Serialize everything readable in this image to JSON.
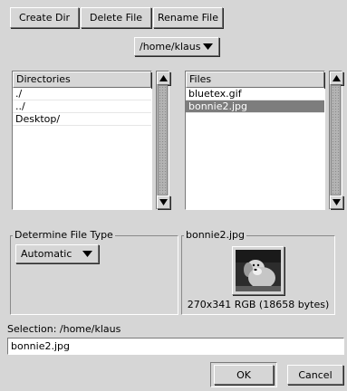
{
  "toolbar": {
    "create_dir": "Create Dir",
    "delete_file": "Delete File",
    "rename_file": "Rename File"
  },
  "path_menu": {
    "value": "/home/klaus"
  },
  "directories": {
    "header": "Directories",
    "items": [
      "./",
      "../",
      "Desktop/"
    ]
  },
  "files": {
    "header": "Files",
    "items": [
      "bluetex.gif",
      "bonnie2.jpg"
    ],
    "selected": "bonnie2.jpg"
  },
  "file_type": {
    "title": "Determine File Type",
    "value": "Automatic"
  },
  "preview": {
    "title": "bonnie2.jpg",
    "info": "270x341 RGB (18658 bytes)"
  },
  "selection": {
    "label": "Selection: /home/klaus",
    "value": "bonnie2.jpg"
  },
  "buttons": {
    "ok": "OK",
    "cancel": "Cancel"
  },
  "icons": {
    "arrow_up": "up-arrow-icon",
    "arrow_down": "down-arrow-icon",
    "menu": "dropdown-triangle-icon"
  }
}
